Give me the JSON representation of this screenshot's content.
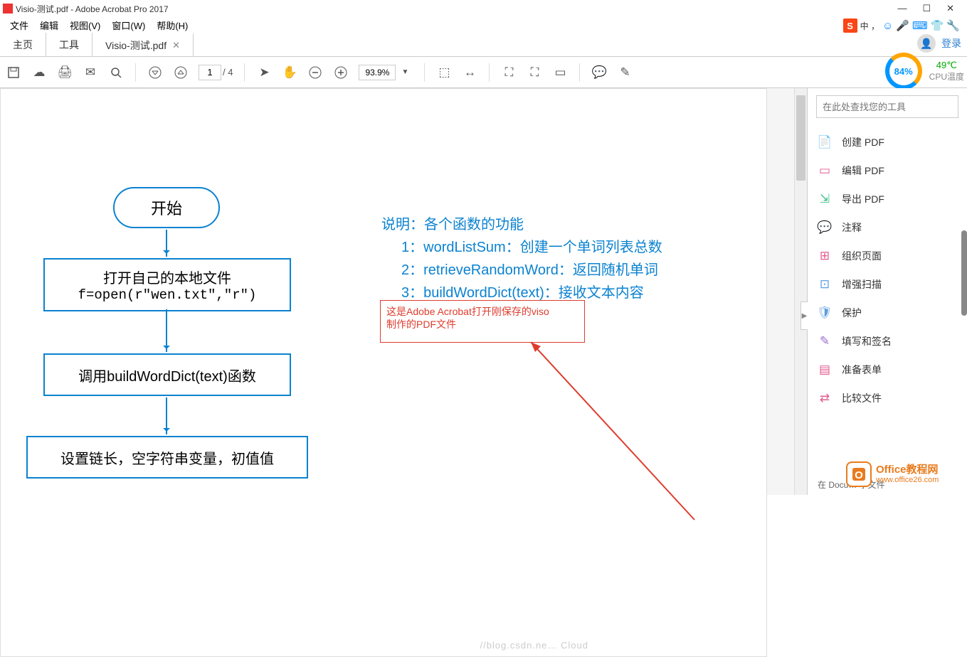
{
  "title": "Visio-测试.pdf - Adobe Acrobat Pro 2017",
  "menu": {
    "file": "文件",
    "edit": "编辑",
    "view": "视图(V)",
    "window": "窗口(W)",
    "help": "帮助(H)"
  },
  "tabs": {
    "home": "主页",
    "tools": "工具",
    "doc": "Visio-测试.pdf"
  },
  "login": "登录",
  "page": {
    "current": "1",
    "total": "/ 4"
  },
  "zoom": "93.9%",
  "cpu": {
    "pct": "84%",
    "temp": "49℃",
    "label": "CPU温度"
  },
  "float": {
    "lang": "中 ，"
  },
  "flow": {
    "start": "开始",
    "box1a": "打开自己的本地文件",
    "box1b": "f=open(r\"wen.txt\",\"r\")",
    "box2": "调用buildWordDict(text)函数",
    "box3": "设置链长，空字符串变量，初值值"
  },
  "explain": {
    "title": "说明：各个函数的功能",
    "l1": "1：wordListSum：创建一个单词列表总数",
    "l2": "2：retrieveRandomWord：返回随机单词",
    "l3": "3：buildWordDict(text)：接收文本内容"
  },
  "annot": {
    "l1": "这是Adobe Acrobat打开刚保存的viso",
    "l2": "制作的PDF文件"
  },
  "rp": {
    "search_ph": "在此处查找您的工具",
    "items": [
      "创建 PDF",
      "编辑 PDF",
      "导出 PDF",
      "注释",
      "组织页面",
      "增强扫描",
      "保护",
      "填写和签名",
      "准备表单",
      "比较文件"
    ],
    "footer": "在 Docu…  享文件"
  },
  "faint": "//blog.csdn.ne… Cloud",
  "wm": {
    "title": "Office教程网",
    "url": "www.office26.com"
  },
  "icons": {
    "colors": [
      "#e2584e",
      "#e35a8f",
      "#43c18b",
      "#f0a22a",
      "#e35a8f",
      "#5c9ee0",
      "#5c9ee0",
      "#9c6ccf",
      "#e35a8f",
      "#e35a8f"
    ]
  }
}
